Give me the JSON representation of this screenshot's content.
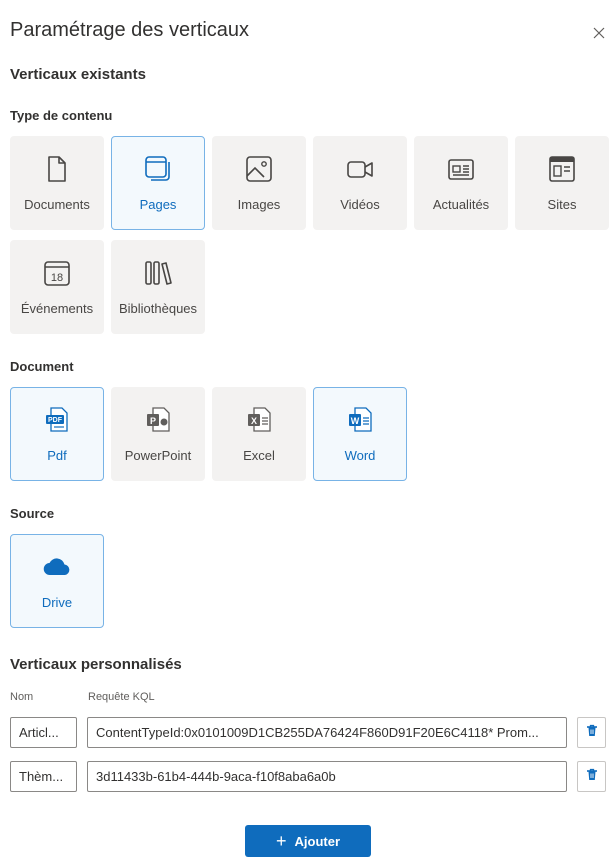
{
  "panel": {
    "title": "Paramétrage des verticaux"
  },
  "existing": {
    "heading": "Verticaux existants"
  },
  "content_type": {
    "heading": "Type de contenu",
    "items": [
      {
        "label": "Documents",
        "icon": "document-icon",
        "selected": false
      },
      {
        "label": "Pages",
        "icon": "pages-icon",
        "selected": true
      },
      {
        "label": "Images",
        "icon": "image-icon",
        "selected": false
      },
      {
        "label": "Vidéos",
        "icon": "video-icon",
        "selected": false
      },
      {
        "label": "Actualités",
        "icon": "news-icon",
        "selected": false
      },
      {
        "label": "Sites",
        "icon": "site-icon",
        "selected": false
      },
      {
        "label": "Événements",
        "icon": "calendar-icon",
        "selected": false
      },
      {
        "label": "Bibliothèques",
        "icon": "library-icon",
        "selected": false
      }
    ]
  },
  "document": {
    "heading": "Document",
    "items": [
      {
        "label": "Pdf",
        "icon": "pdf-icon",
        "selected": true
      },
      {
        "label": "PowerPoint",
        "icon": "powerpoint-icon",
        "selected": false
      },
      {
        "label": "Excel",
        "icon": "excel-icon",
        "selected": false
      },
      {
        "label": "Word",
        "icon": "word-icon",
        "selected": true
      }
    ]
  },
  "source": {
    "heading": "Source",
    "items": [
      {
        "label": "Drive",
        "icon": "cloud-icon",
        "selected": true
      }
    ]
  },
  "custom": {
    "heading": "Verticaux personnalisés",
    "col_name": "Nom",
    "col_query": "Requête KQL",
    "rows": [
      {
        "name": "Articl...",
        "query": "ContentTypeId:0x0101009D1CB255DA76424F860D91F20E6C4118* Prom..."
      },
      {
        "name": "Thèm...",
        "query": "3d11433b-61b4-444b-9aca-f10f8aba6a0b"
      }
    ]
  },
  "actions": {
    "add_label": "Ajouter"
  },
  "colors": {
    "accent": "#0f6cbd",
    "tile_bg": "#f3f2f1",
    "selected_bg": "#f3f9fd",
    "selected_border": "#78b3e6",
    "danger": "#0f6cbd"
  }
}
